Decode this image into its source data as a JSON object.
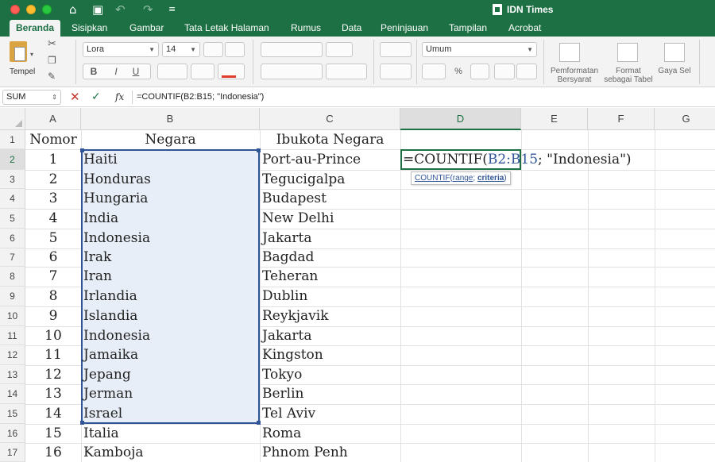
{
  "window": {
    "title": "IDN Times"
  },
  "colors": {
    "brand": "#1d7044",
    "selection_border": "#2f5597",
    "selection_fill": "#e8eef7",
    "cancel": "#c4342b"
  },
  "icons": [
    "home-icon",
    "save-icon",
    "undo-icon",
    "redo-icon",
    "customize-icon",
    "paste-icon",
    "cut-icon",
    "copy-icon",
    "format-painter-icon",
    "cancel-icon",
    "enter-icon",
    "function-icon"
  ],
  "ribbon_tabs": [
    "Beranda",
    "Sisipkan",
    "Gambar",
    "Tata Letak Halaman",
    "Rumus",
    "Data",
    "Peninjauan",
    "Tampilan",
    "Acrobat"
  ],
  "ribbon": {
    "paste_label": "Tempel",
    "font_name": "Lora",
    "font_size": "14",
    "number_format": "Umum",
    "conditional_formatting": "Pemformatan Bersyarat",
    "format_as_table": "Format sebagai Tabel",
    "cell_styles": "Gaya Sel",
    "bold": "B",
    "italic": "I",
    "underline": "U",
    "percent": "%"
  },
  "formula_bar": {
    "name_box": "SUM",
    "fx": "fx",
    "content": "=COUNTIF(B2:B15; \"Indonesia\")"
  },
  "columns": [
    "A",
    "B",
    "C",
    "D",
    "E",
    "F",
    "G"
  ],
  "headers": {
    "nomor": "Nomor",
    "negara": "Negara",
    "ibukota": "Ibukota Negara"
  },
  "rows": [
    {
      "row": "2",
      "nomor": "1",
      "negara": "Haiti",
      "ibukota": "Port-au-Prince"
    },
    {
      "row": "3",
      "nomor": "2",
      "negara": "Honduras",
      "ibukota": "Tegucigalpa"
    },
    {
      "row": "4",
      "nomor": "3",
      "negara": "Hungaria",
      "ibukota": "Budapest"
    },
    {
      "row": "5",
      "nomor": "4",
      "negara": "India",
      "ibukota": "New Delhi"
    },
    {
      "row": "6",
      "nomor": "5",
      "negara": "Indonesia",
      "ibukota": "Jakarta"
    },
    {
      "row": "7",
      "nomor": "6",
      "negara": "Irak",
      "ibukota": "Bagdad"
    },
    {
      "row": "8",
      "nomor": "7",
      "negara": "Iran",
      "ibukota": "Teheran"
    },
    {
      "row": "9",
      "nomor": "8",
      "negara": "Irlandia",
      "ibukota": "Dublin"
    },
    {
      "row": "10",
      "nomor": "9",
      "negara": "Islandia",
      "ibukota": "Reykjavik"
    },
    {
      "row": "11",
      "nomor": "10",
      "negara": "Indonesia",
      "ibukota": "Jakarta"
    },
    {
      "row": "12",
      "nomor": "11",
      "negara": "Jamaika",
      "ibukota": "Kingston"
    },
    {
      "row": "13",
      "nomor": "12",
      "negara": "Jepang",
      "ibukota": "Tokyo"
    },
    {
      "row": "14",
      "nomor": "13",
      "negara": "Jerman",
      "ibukota": "Berlin"
    },
    {
      "row": "15",
      "nomor": "14",
      "negara": "Israel",
      "ibukota": "Tel Aviv"
    },
    {
      "row": "16",
      "nomor": "15",
      "negara": "Italia",
      "ibukota": "Roma"
    },
    {
      "row": "17",
      "nomor": "16",
      "negara": "Kamboja",
      "ibukota": "Phnom Penh"
    }
  ],
  "active_cell": {
    "prefix": "=COUNTIF(",
    "ref": "B2:B15",
    "suffix": "; \"Indonesia\")"
  },
  "tooltip": {
    "fn": "COUNTIF",
    "open": "(",
    "arg1": "range",
    "sep": "; ",
    "arg2": "criteria",
    "close": ")"
  }
}
